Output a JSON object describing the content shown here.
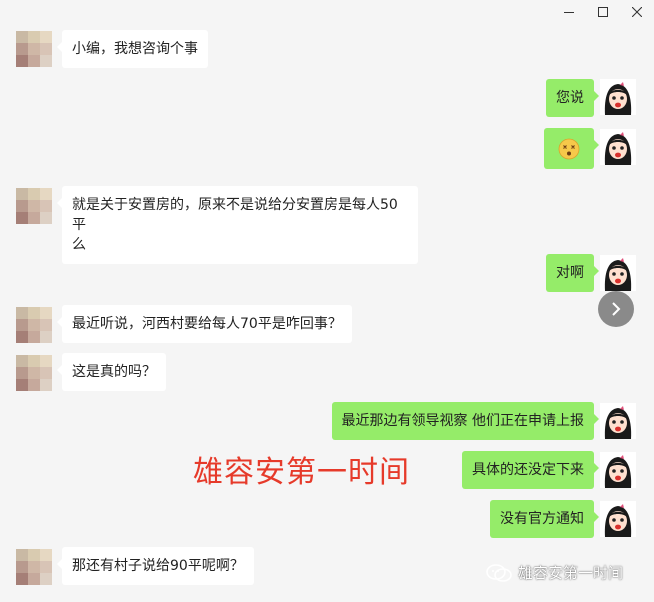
{
  "window": {
    "minimize_icon": "minimize-icon",
    "maximize_icon": "maximize-icon",
    "close_icon": "close-icon"
  },
  "messages": [
    {
      "side": "left",
      "text": "小编，我想咨询个事"
    },
    {
      "side": "right",
      "text": "您说"
    },
    {
      "side": "right",
      "emoji": "dizzy-face-emoji"
    },
    {
      "side": "left",
      "line1": "就是关于安置房的，原来不是说给分安置房是每人50平",
      "line2": "么"
    },
    {
      "side": "right",
      "text": "对啊"
    },
    {
      "side": "left",
      "text": "最近听说，河西村要给每人70平是咋回事？"
    },
    {
      "side": "left",
      "text": "这是真的吗？"
    },
    {
      "side": "right",
      "text": "最近那边有领导视察 他们正在申请上报"
    },
    {
      "side": "right",
      "text": "具体的还没定下来"
    },
    {
      "side": "right",
      "text": "没有官方通知"
    },
    {
      "side": "left",
      "text": "那还有村子说给90平呢啊？"
    }
  ],
  "overlay": {
    "red_caption": "雄容安第一时间",
    "source_name": "雄容安第一时间"
  },
  "colors": {
    "background": "#f5f5f5",
    "bubble_left": "#ffffff",
    "bubble_right": "#95ec69",
    "red_caption": "#e63a2a"
  }
}
